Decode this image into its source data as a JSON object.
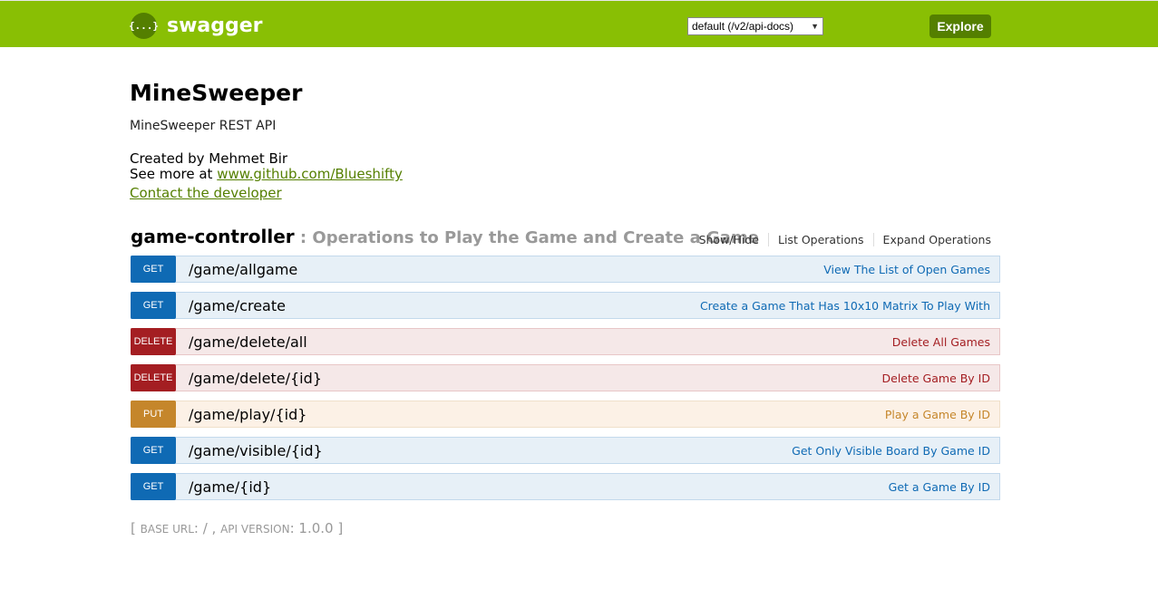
{
  "header": {
    "logo_icon": "{...}",
    "logo_text": "swagger",
    "spec_select_value": "default (/v2/api-docs)",
    "explore_label": "Explore",
    "brand_color": "#89bf04"
  },
  "info": {
    "title": "MineSweeper",
    "description": "MineSweeper REST API",
    "created_by": "Created by Mehmet Bir",
    "see_more_prefix": "See more at ",
    "see_more_link": "www.github.com/Blueshifty",
    "contact_link": "Contact the developer"
  },
  "controller": {
    "name": "game-controller",
    "separator": " : ",
    "description": "Operations to Play the Game and Create a Game",
    "links": [
      "Show/Hide",
      "List Operations",
      "Expand Operations"
    ]
  },
  "operations": [
    {
      "method": "GET",
      "path": "/game/allgame",
      "summary": "View The List of Open Games"
    },
    {
      "method": "GET",
      "path": "/game/create",
      "summary": "Create a Game That Has 10x10 Matrix To Play With"
    },
    {
      "method": "DELETE",
      "path": "/game/delete/all",
      "summary": "Delete All Games"
    },
    {
      "method": "DELETE",
      "path": "/game/delete/{id}",
      "summary": "Delete Game By ID"
    },
    {
      "method": "PUT",
      "path": "/game/play/{id}",
      "summary": "Play a Game By ID"
    },
    {
      "method": "GET",
      "path": "/game/visible/{id}",
      "summary": "Get Only Visible Board By Game ID"
    },
    {
      "method": "GET",
      "path": "/game/{id}",
      "summary": "Get a Game By ID"
    }
  ],
  "footer": {
    "open": "[ ",
    "base_url_label": "Base URL",
    "base_url_value": ": / , ",
    "api_version_label": "Api Version",
    "api_version_value": ": 1.0.0 ",
    "close": "]"
  }
}
